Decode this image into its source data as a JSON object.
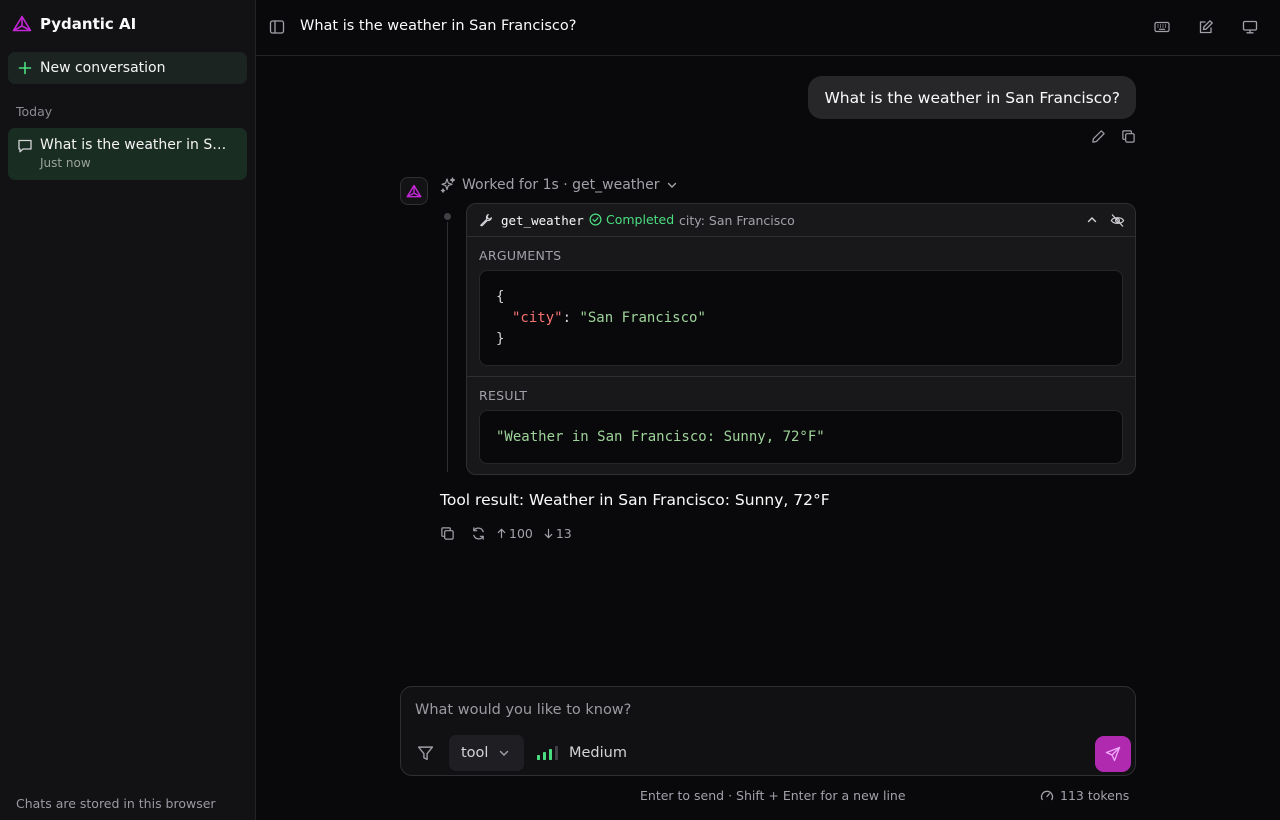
{
  "colors": {
    "accent": "#b02ab0",
    "success": "#4ade80",
    "active_conversation": "#1a2d22",
    "brand_logo": "#c026d3"
  },
  "sidebar": {
    "brand": "Pydantic AI",
    "brand_icon": "pydantic-logo-icon",
    "new_conversation": "New conversation",
    "section": "Today",
    "conversations": [
      {
        "title": "What is the weather in San Francisco?",
        "time": "Just now"
      }
    ],
    "footer": "Chats are stored in this browser"
  },
  "header": {
    "title": "What is the weather in San Francisco?",
    "icons": [
      "sidebar-toggle-icon",
      "keyboard-icon",
      "edit-icon",
      "monitor-icon"
    ]
  },
  "messages": {
    "user": {
      "text": "What is the weather in San Francisco?"
    },
    "assistant": {
      "worked_label": "Worked for 1s · get_weather",
      "tool": {
        "name": "get_weather",
        "status": "Completed",
        "summary": "city: San Francisco",
        "arguments_label": "ARGUMENTS",
        "arguments": {
          "open": "{",
          "key": "\"city\"",
          "colon": ": ",
          "value": "\"San Francisco\"",
          "close": "}"
        },
        "result_label": "RESULT",
        "result": "\"Weather in San Francisco: Sunny, 72°F\""
      },
      "text": "Tool result: Weather in San Francisco: Sunny, 72°F",
      "tokens_in": "100",
      "tokens_out": "13"
    }
  },
  "composer": {
    "placeholder": "What would you like to know?",
    "model": "tool",
    "effort": "Medium",
    "effort_level": 3,
    "effort_max": 4,
    "hint": "Enter to send · Shift + Enter for a new line",
    "token_count": "113 tokens"
  }
}
